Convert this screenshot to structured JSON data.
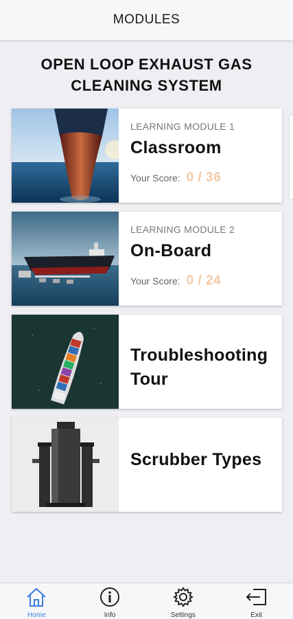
{
  "header": {
    "title": "MODULES"
  },
  "page": {
    "heading_line1": "OPEN LOOP EXHAUST GAS",
    "heading_line2": "CLEANING SYSTEM"
  },
  "modules": [
    {
      "label": "LEARNING MODULE 1",
      "title": "Classroom",
      "score_label": "Your Score:",
      "score": "0 / 36",
      "image": "ship-bow-photo"
    },
    {
      "label": "LEARNING MODULE 2",
      "title": "On-Board",
      "score_label": "Your Score:",
      "score": "0 / 24",
      "image": "tanker-at-sea-photo"
    },
    {
      "title_line1": "Troubleshooting",
      "title_line2": "Tour",
      "image": "container-ship-aerial-photo"
    },
    {
      "title": "Scrubber Types",
      "image": "scrubber-unit-photo"
    }
  ],
  "nav": {
    "items": [
      {
        "label": "Home",
        "icon": "home-icon",
        "active": true
      },
      {
        "label": "Info",
        "icon": "info-icon",
        "active": false
      },
      {
        "label": "Settings",
        "icon": "gear-icon",
        "active": false
      },
      {
        "label": "Exit",
        "icon": "exit-icon",
        "active": false
      }
    ]
  },
  "colors": {
    "accent": "#3b7de0",
    "score": "#f4c9a6",
    "background": "#eeeef3"
  }
}
